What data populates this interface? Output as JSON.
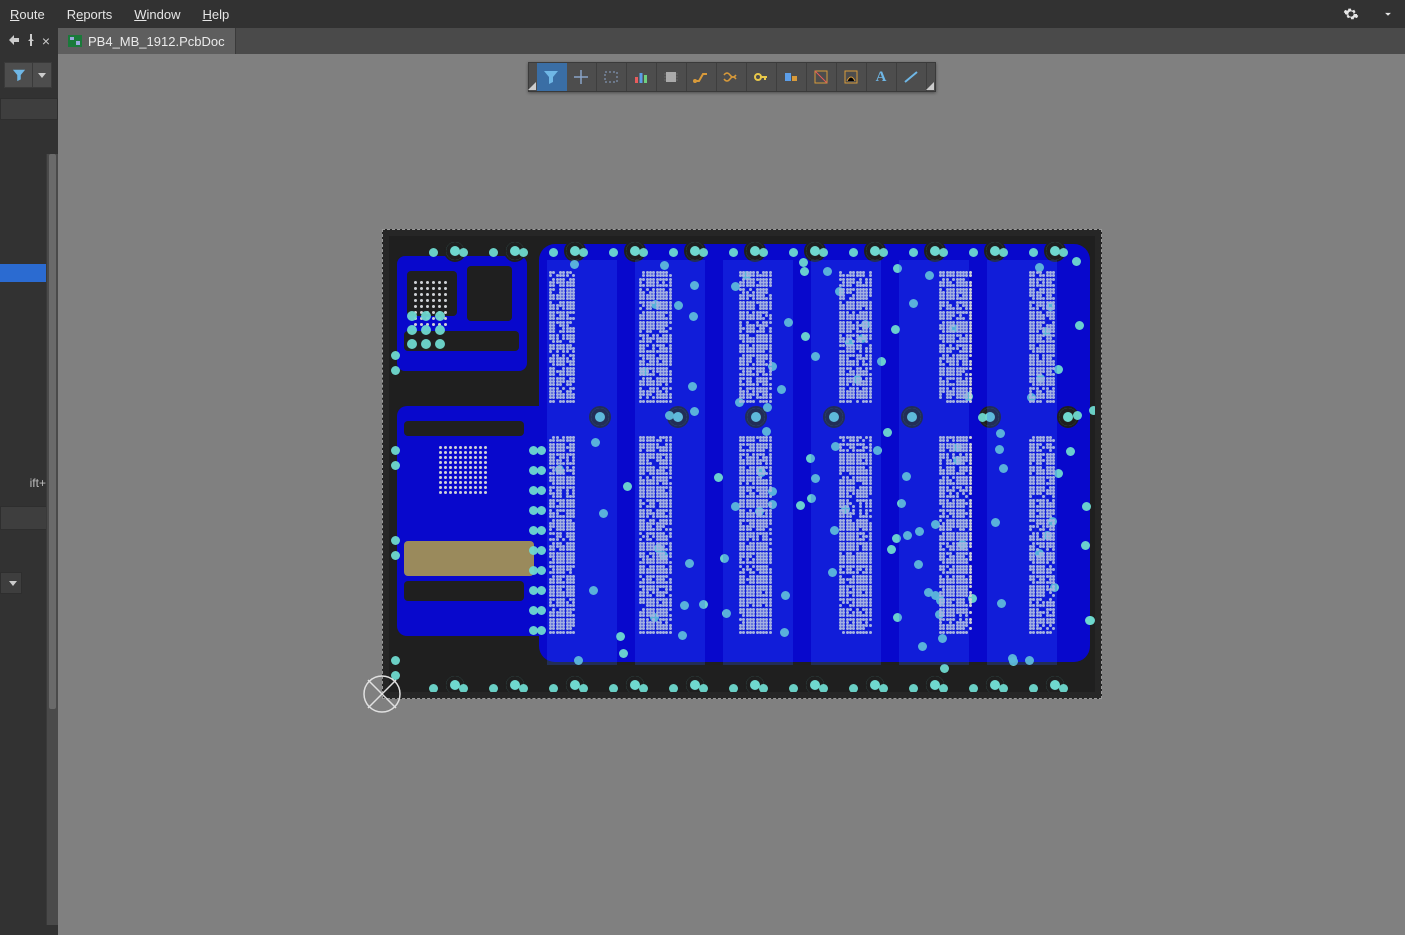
{
  "menu": {
    "route": "Route",
    "reports": "Reports",
    "window": "Window",
    "help": "Help"
  },
  "titlebar_icons": {
    "settings": "gear-icon",
    "more": "arrow-icon"
  },
  "document_tab": {
    "label": "PB4_MB_1912.PcbDoc",
    "icon": "pcb-doc-icon"
  },
  "panel_controls": {
    "dock": "dock-arrow",
    "pin": "pin",
    "close": "×"
  },
  "left_toolbar": {
    "filter_btn": "funnel-icon",
    "dropdown_btn": "chevron-down-icon"
  },
  "side_fragments": {
    "shortcut_hint": "ift+E"
  },
  "active_filter_toolbar": {
    "tools": [
      {
        "name": "filter-funnel-icon",
        "selected": true
      },
      {
        "name": "crosshair-icon",
        "selected": false
      },
      {
        "name": "selection-rect-icon",
        "selected": false
      },
      {
        "name": "graph-bars-icon",
        "selected": false
      },
      {
        "name": "component-icon",
        "selected": false
      },
      {
        "name": "route-track-icon",
        "selected": false
      },
      {
        "name": "diff-pair-icon",
        "selected": false
      },
      {
        "name": "key-icon",
        "selected": false
      },
      {
        "name": "region-align-icon",
        "selected": false
      },
      {
        "name": "clearance-icon",
        "selected": false
      },
      {
        "name": "measure-icon",
        "selected": false
      },
      {
        "name": "text-A-icon",
        "selected": false
      },
      {
        "name": "line-segment-icon",
        "selected": false
      }
    ]
  },
  "canvas": {
    "background": "#808080",
    "board_outline_color": "#999999",
    "copper_color": "#0808cc",
    "via_color": "#6fd9cf",
    "pad_dot_color": "#cfd2d6",
    "origin_marker": "crossed-circle"
  }
}
